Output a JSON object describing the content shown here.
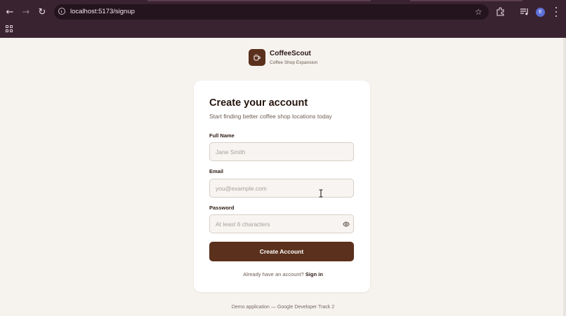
{
  "browser": {
    "url": "localhost:5173/signup",
    "profile_initial": "E",
    "icons": [
      "back-arrow-icon",
      "forward-arrow-icon",
      "reload-icon",
      "site-info-icon",
      "bookmark-star-icon",
      "extensions-icon",
      "media-controls-icon",
      "kebab-menu-icon",
      "apps-grid-icon"
    ]
  },
  "brand": {
    "name": "CoffeeScout",
    "tagline": "Coffee Shop Expansion",
    "icon": "coffee-cup-icon",
    "color": "#5b301c"
  },
  "form": {
    "title": "Create your account",
    "subtitle": "Start finding better coffee shop locations today",
    "full_name": {
      "label": "Full Name",
      "placeholder": "Jane Smith",
      "value": ""
    },
    "email": {
      "label": "Email",
      "placeholder": "you@example.com",
      "value": ""
    },
    "password": {
      "label": "Password",
      "placeholder": "At least 6 characters",
      "value": "",
      "toggle_icon": "eye-icon"
    },
    "submit_label": "Create Account",
    "signin_prompt": "Already have an account?",
    "signin_link": "Sign in"
  },
  "footer": "Demo application — Google Developer Track 2",
  "colors": {
    "background": "#f6f3ef",
    "accent": "#5b301c",
    "chrome": "#3a2331"
  }
}
